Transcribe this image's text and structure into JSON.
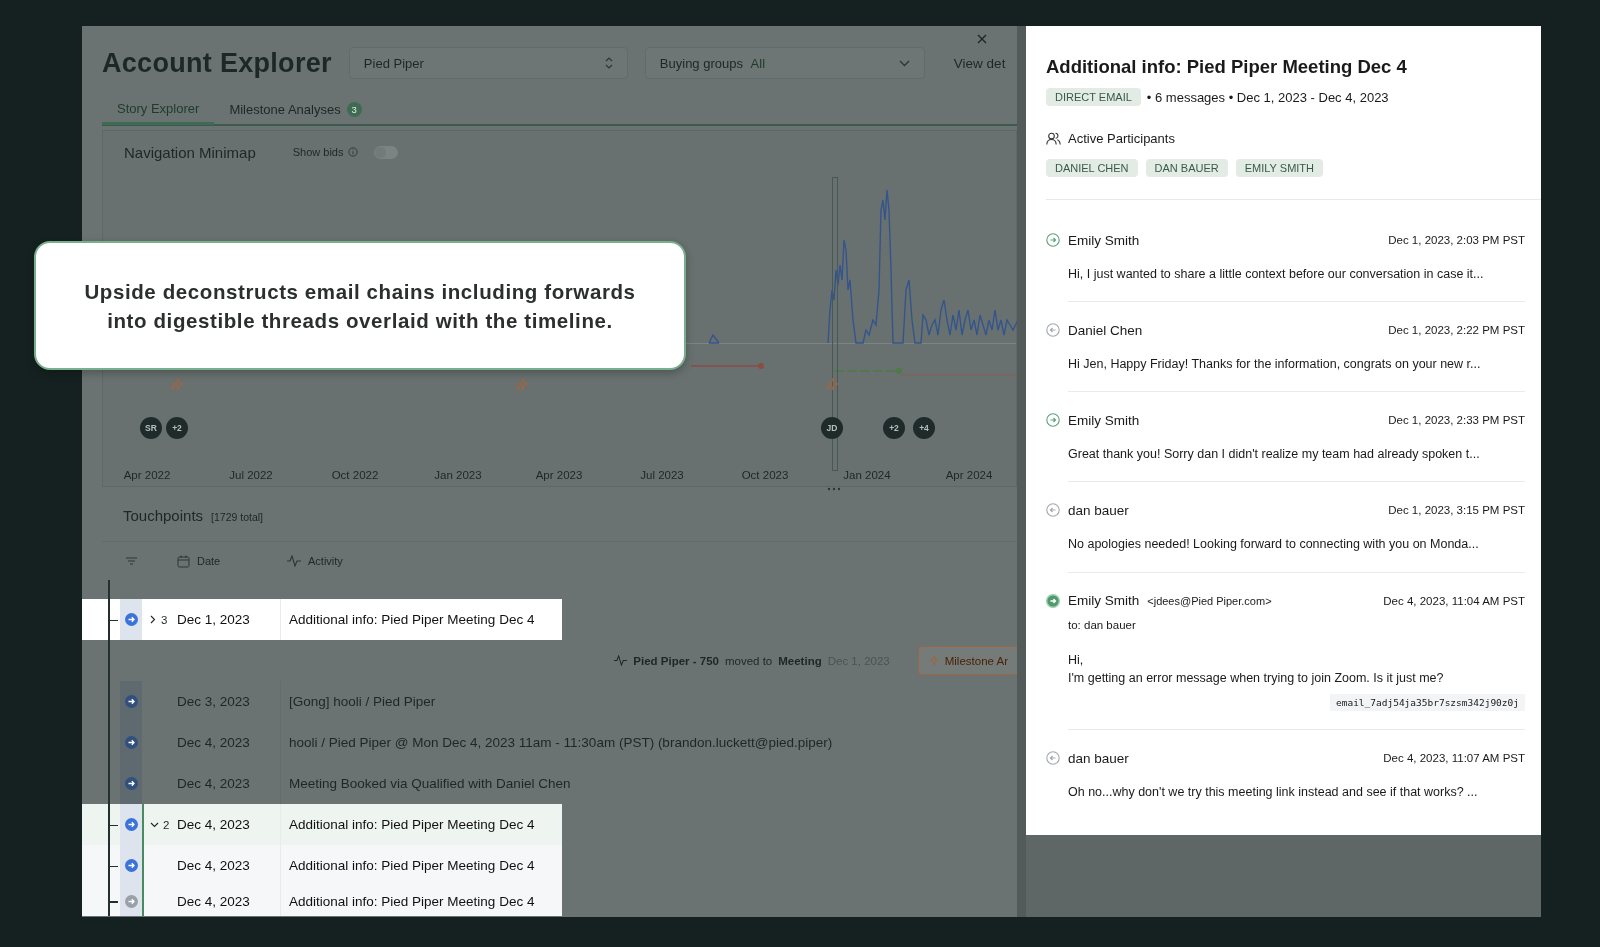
{
  "header": {
    "title": "Account Explorer",
    "account_select": "Pied Piper",
    "buying_groups": {
      "label": "Buying groups",
      "value": "All"
    },
    "view_button": "View det"
  },
  "tabs": [
    {
      "label": "Story Explorer",
      "selected": true
    },
    {
      "label": "Milestone Analyses",
      "selected": false,
      "badge": "3"
    }
  ],
  "minimap": {
    "title": "Navigation Minimap",
    "show_bids": {
      "label": "Show bids",
      "on": false
    },
    "x_labels": [
      "Apr 2022",
      "Jul 2022",
      "Oct 2022",
      "Jan 2023",
      "Apr 2023",
      "Jul 2023",
      "Oct 2023",
      "Jan 2024",
      "Apr 2024"
    ],
    "avatars": [
      "SR",
      "+2",
      "JD",
      "+2",
      "+4"
    ]
  },
  "callout": "Upside deconstructs email chains including forwards into digestible threads overlaid with the timeline.",
  "touchpoints": {
    "title": "Touchpoints",
    "total": "[1729 total]",
    "columns": [
      "Date",
      "Activity"
    ],
    "rows": [
      {
        "kind": "email",
        "date": "Dec 1, 2023",
        "activity": "Additional info: Pied Piper Meeting Dec 4",
        "count": "3",
        "expanded": false,
        "highlighted": true,
        "color": "#3b73d9"
      },
      {
        "kind": "milestone",
        "deal": "Pied Piper - 750",
        "verb": "moved to",
        "stage": "Meeting",
        "date": "Dec 1, 2023",
        "button": "Milestone Ar"
      },
      {
        "kind": "email",
        "date": "Dec 3, 2023",
        "activity": "[Gong] hooli / Pied Piper",
        "highlighted": false,
        "color": "#31507e"
      },
      {
        "kind": "email",
        "date": "Dec 4, 2023",
        "activity": "hooli / Pied Piper @ Mon Dec 4, 2023 11am - 11:30am (PST) (brandon.luckett@pied.piper)",
        "highlighted": false,
        "color": "#31507e"
      },
      {
        "kind": "email",
        "date": "Dec 4, 2023",
        "activity": "Meeting Booked via Qualified with Daniel Chen",
        "highlighted": false,
        "color": "#31507e"
      },
      {
        "kind": "email",
        "date": "Dec 4, 2023",
        "activity": "Additional info: Pied Piper Meeting Dec 4",
        "count": "2",
        "expanded": true,
        "highlighted": true,
        "color": "#3b73d9",
        "children": [
          {
            "kind": "email",
            "date": "Dec 4, 2023",
            "activity": "Additional info: Pied Piper Meeting Dec 4",
            "highlighted": true,
            "color": "#3b73d9"
          },
          {
            "kind": "email",
            "date": "Dec 4, 2023",
            "activity": "Additional info: Pied Piper Meeting Dec 4",
            "highlighted": true,
            "color": "#9aa0a6"
          }
        ]
      }
    ]
  },
  "detail": {
    "title": "Additional info: Pied Piper Meeting Dec 4",
    "channel": "DIRECT EMAIL",
    "summary": "• 6 messages • Dec 1, 2023 - Dec 4, 2023",
    "participants_label": "Active Participants",
    "participants": [
      "DANIEL CHEN",
      "DAN BAUER",
      "EMILY SMITH"
    ],
    "messages": [
      {
        "kind": "outgoing",
        "selected": false,
        "sender": "Emily Smith",
        "time": "Dec 1, 2023, 2:03 PM PST",
        "body": "Hi, I just wanted to share a little context before our conversation in case it..."
      },
      {
        "kind": "incoming",
        "selected": false,
        "sender": "Daniel Chen",
        "time": "Dec 1, 2023, 2:22 PM PST",
        "body": "Hi Jen, Happy Friday! Thanks for the information, congrats on your new r..."
      },
      {
        "kind": "outgoing",
        "selected": false,
        "sender": "Emily Smith",
        "time": "Dec 1, 2023, 2:33 PM PST",
        "body": "Great thank you! Sorry dan I didn't realize my team had already spoken t..."
      },
      {
        "kind": "incoming",
        "selected": false,
        "sender": "dan bauer",
        "time": "Dec 1, 2023, 3:15 PM PST",
        "body": "No apologies needed! Looking forward to connecting with you on Monda..."
      },
      {
        "kind": "outgoing",
        "selected": true,
        "sender": "Emily Smith",
        "address": "<jdees@Pied Piper.com>",
        "time": "Dec 4, 2023, 11:04 AM PST",
        "to": "to: dan bauer",
        "body": "Hi,\nI'm getting an error message when trying to join Zoom. Is it just me?",
        "code": "email_7adj54ja35br7szsm342j90z0j"
      },
      {
        "kind": "incoming",
        "selected": false,
        "sender": "dan bauer",
        "time": "Dec 4, 2023, 11:07 AM PST",
        "body": "Oh no...why don't we try this meeting link instead and see if that works? ..."
      }
    ]
  }
}
